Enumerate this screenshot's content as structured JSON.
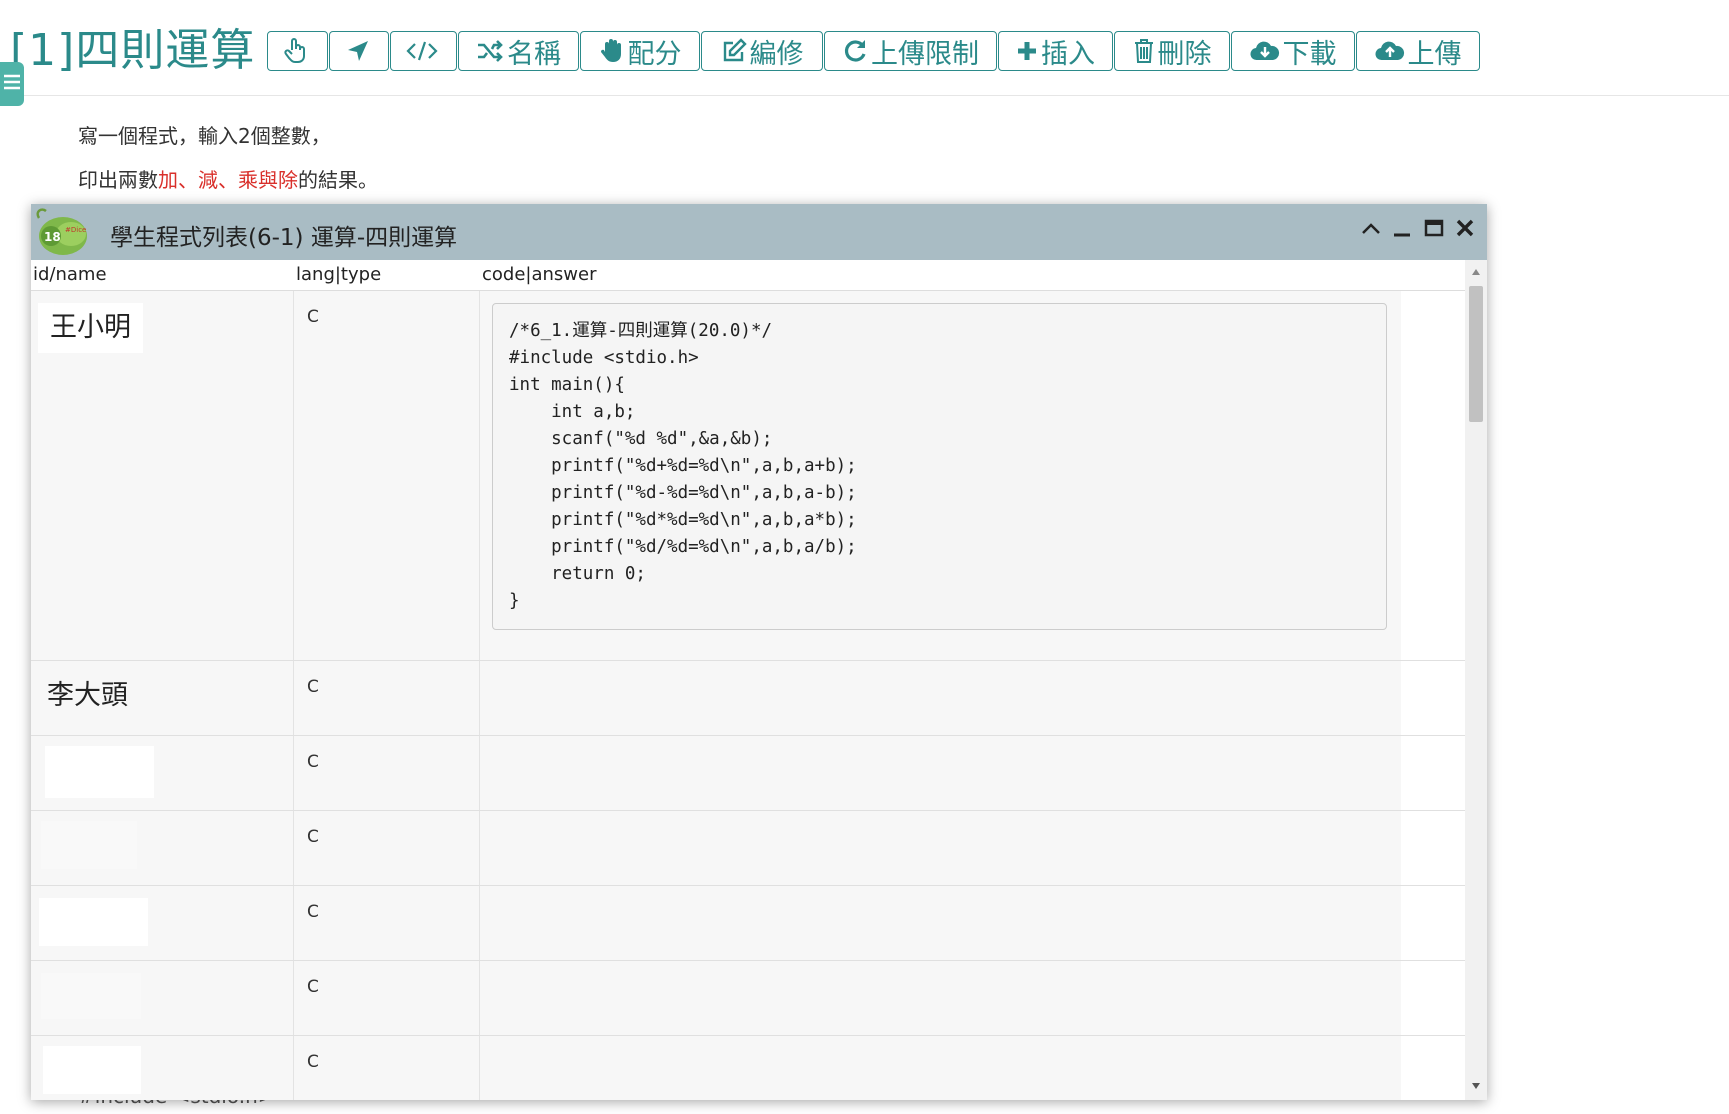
{
  "page": {
    "title": "[1]四則運算",
    "description": {
      "line1": "寫一個程式，輸入2個整數，",
      "line2_prefix": "印出兩數",
      "line2_add": "加",
      "line2_sep1": "、",
      "line2_sub": "減",
      "line2_sep2": "、",
      "line2_muldiv": "乘與除",
      "line2_suffix": "的結果。"
    },
    "behind_text": "#include <stdio.h>"
  },
  "toolbar": {
    "buttons": [
      {
        "label": "",
        "icon": "hand-pointer-icon"
      },
      {
        "label": "",
        "icon": "location-arrow-icon"
      },
      {
        "label": "",
        "icon": "code-icon"
      },
      {
        "label": "名稱",
        "icon": "random-icon"
      },
      {
        "label": "配分",
        "icon": "hand-paper-icon"
      },
      {
        "label": "編修",
        "icon": "edit-icon"
      },
      {
        "label": "上傳限制",
        "icon": "refresh-icon"
      },
      {
        "label": "插入",
        "icon": "plus-icon"
      },
      {
        "label": "刪除",
        "icon": "trash-icon"
      },
      {
        "label": "下載",
        "icon": "cloud-download-icon"
      },
      {
        "label": "上傳",
        "icon": "cloud-upload-icon"
      }
    ]
  },
  "dialog": {
    "title": "學生程式列表(6-1) 運算-四則運算",
    "logo_text": "18",
    "logo_subtext": "#Dice",
    "columns": {
      "name": "id/name",
      "lang": "lang|type",
      "code": "code|answer"
    },
    "rows": [
      {
        "name": "王小明",
        "lang": "C",
        "code": "/*6_1.運算-四則運算(20.0)*/\n#include <stdio.h>\nint main(){\n    int a,b;\n    scanf(\"%d %d\",&a,&b);\n    printf(\"%d+%d=%d\\n\",a,b,a+b);\n    printf(\"%d-%d=%d\\n\",a,b,a-b);\n    printf(\"%d*%d=%d\\n\",a,b,a*b);\n    printf(\"%d/%d=%d\\n\",a,b,a/b);\n    return 0;\n}"
      },
      {
        "name": "李大頭",
        "lang": "C",
        "code": ""
      },
      {
        "name": "",
        "lang": "C",
        "code": ""
      },
      {
        "name": "",
        "lang": "C",
        "code": ""
      },
      {
        "name": "",
        "lang": "C",
        "code": ""
      },
      {
        "name": "",
        "lang": "C",
        "code": ""
      },
      {
        "name": "",
        "lang": "C",
        "code": ""
      }
    ]
  },
  "colors": {
    "accent": "#2b8a8a",
    "titlebar": "#a9bcc4",
    "sidebar_toggle": "#4fb3a8",
    "highlight_red": "#d9302b"
  }
}
